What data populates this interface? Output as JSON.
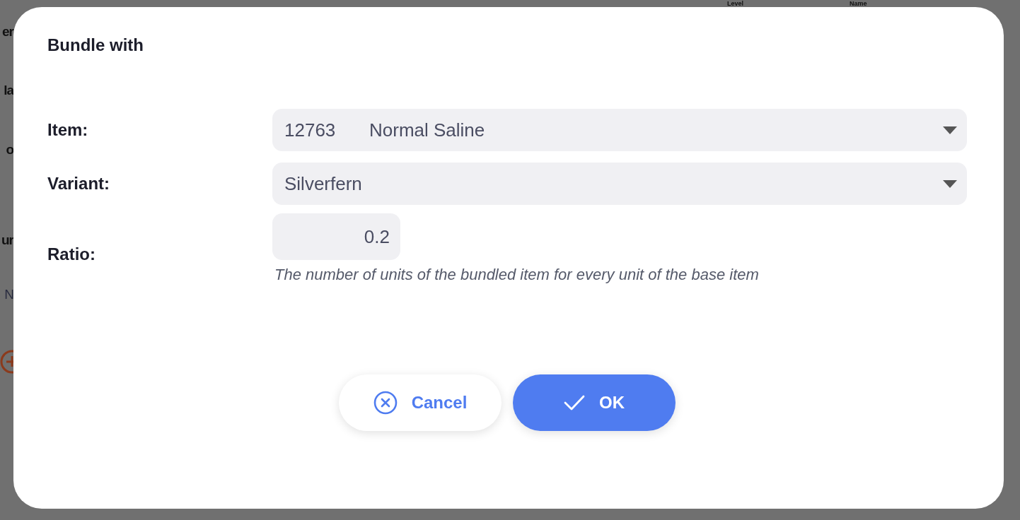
{
  "background": {
    "column_headers": [
      "Level",
      "Name"
    ],
    "left_fragments": [
      "er",
      "la",
      "o",
      "ur",
      "N"
    ]
  },
  "dialog": {
    "title": "Bundle with",
    "fields": [
      {
        "kind": "select",
        "label": "Item:",
        "code": "12763",
        "value": "Normal Saline"
      },
      {
        "kind": "select",
        "label": "Variant:",
        "value": "Silverfern"
      },
      {
        "kind": "number",
        "label": "Ratio:",
        "value": "0.2",
        "hint": "The number of units of the bundled item for every unit of the base item"
      }
    ],
    "buttons": [
      {
        "kind": "cancel",
        "label": "Cancel"
      },
      {
        "kind": "ok",
        "label": "OK"
      }
    ]
  }
}
